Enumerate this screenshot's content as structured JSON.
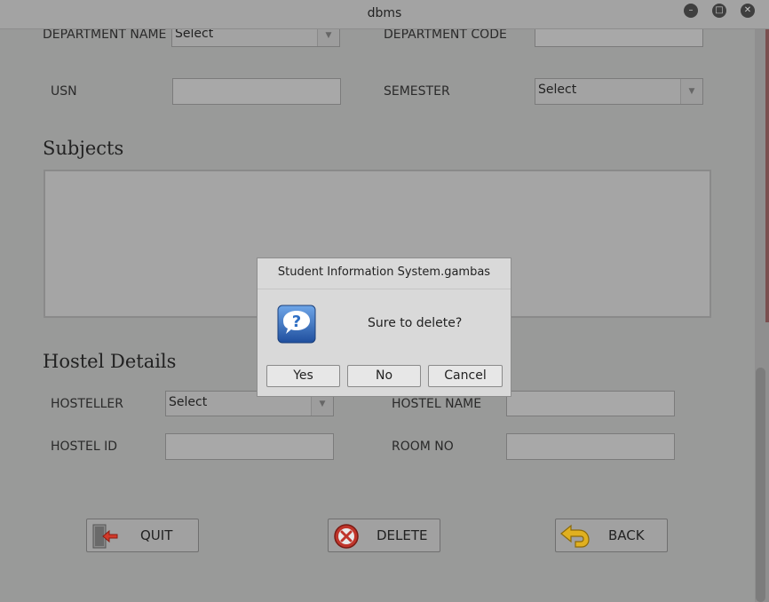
{
  "window": {
    "title": "dbms"
  },
  "form": {
    "department_name_label": "DEPARTMENT NAME",
    "department_name_value": "Select",
    "department_code_label": "DEPARTMENT CODE",
    "department_code_value": "",
    "usn_label": "USN",
    "usn_value": "",
    "semester_label": "SEMESTER",
    "semester_value": "Select"
  },
  "subjects": {
    "heading": "Subjects"
  },
  "hostel": {
    "heading": "Hostel Details",
    "hosteller_label": "HOSTELLER",
    "hosteller_value": "Select",
    "hostel_name_label": "HOSTEL NAME",
    "hostel_name_value": "",
    "hostel_id_label": "HOSTEL ID",
    "hostel_id_value": "",
    "room_no_label": "ROOM NO",
    "room_no_value": ""
  },
  "actions": {
    "quit_label": "QUIT",
    "delete_label": "DELETE",
    "back_label": "BACK"
  },
  "dialog": {
    "title": "Student Information System.gambas",
    "message": "Sure to delete?",
    "yes_label": "Yes",
    "no_label": "No",
    "cancel_label": "Cancel",
    "icon": "question-icon"
  },
  "colors": {
    "dialog_icon_blue": "#2f6fc4",
    "delete_icon_red": "#c0352b",
    "back_icon_yellow": "#e0b020",
    "quit_icon_red": "#d23a2a"
  }
}
